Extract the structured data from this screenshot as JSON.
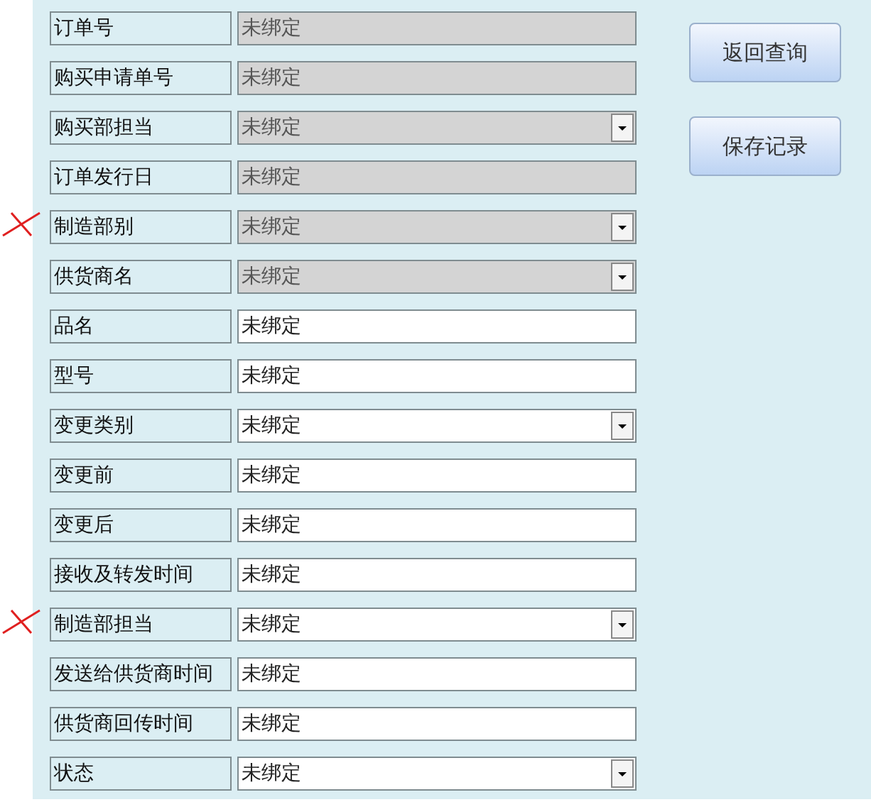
{
  "fields": [
    {
      "label": "订单号",
      "value": "未绑定",
      "kind": "text",
      "disabled": true,
      "marked": false
    },
    {
      "label": "购买申请单号",
      "value": "未绑定",
      "kind": "text",
      "disabled": true,
      "marked": false
    },
    {
      "label": "购买部担当",
      "value": "未绑定",
      "kind": "select",
      "disabled": true,
      "marked": false
    },
    {
      "label": "订单发行日",
      "value": "未绑定",
      "kind": "text",
      "disabled": true,
      "marked": false
    },
    {
      "label": "制造部别",
      "value": "未绑定",
      "kind": "select",
      "disabled": true,
      "marked": true
    },
    {
      "label": "供货商名",
      "value": "未绑定",
      "kind": "select",
      "disabled": true,
      "marked": false
    },
    {
      "label": "品名",
      "value": "未绑定",
      "kind": "text",
      "disabled": false,
      "marked": false
    },
    {
      "label": "型号",
      "value": "未绑定",
      "kind": "text",
      "disabled": false,
      "marked": false
    },
    {
      "label": "变更类别",
      "value": "未绑定",
      "kind": "select",
      "disabled": false,
      "marked": false
    },
    {
      "label": "变更前",
      "value": "未绑定",
      "kind": "text",
      "disabled": false,
      "marked": false
    },
    {
      "label": "变更后",
      "value": "未绑定",
      "kind": "text",
      "disabled": false,
      "marked": false
    },
    {
      "label": "接收及转发时间",
      "value": "未绑定",
      "kind": "text",
      "disabled": false,
      "marked": false
    },
    {
      "label": "制造部担当",
      "value": "未绑定",
      "kind": "select",
      "disabled": false,
      "marked": true
    },
    {
      "label": "发送给供货商时间",
      "value": "未绑定",
      "kind": "text",
      "disabled": false,
      "marked": false
    },
    {
      "label": "供货商回传时间",
      "value": "未绑定",
      "kind": "text",
      "disabled": false,
      "marked": false
    },
    {
      "label": "状态",
      "value": "未绑定",
      "kind": "select",
      "disabled": false,
      "marked": false
    }
  ],
  "buttons": [
    "返回查询",
    "保存记录"
  ]
}
